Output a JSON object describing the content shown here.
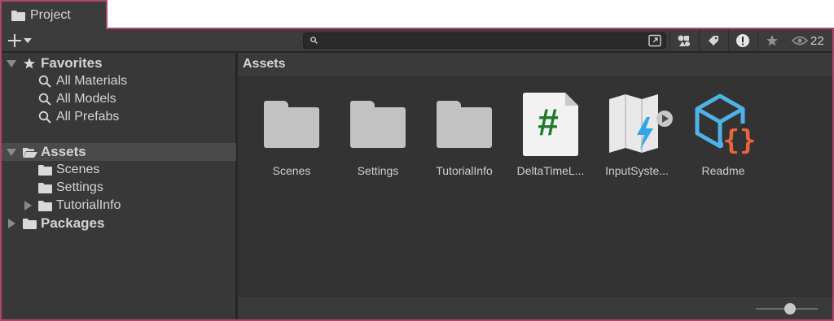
{
  "tab": {
    "title": "Project",
    "icon": "folder-icon"
  },
  "toolbar": {
    "add_icon": "plus-icon",
    "search": {
      "value": "",
      "placeholder": ""
    },
    "hidden_count": "22"
  },
  "tree": {
    "favorites": {
      "label": "Favorites",
      "items": [
        {
          "label": "All Materials"
        },
        {
          "label": "All Models"
        },
        {
          "label": "All Prefabs"
        }
      ]
    },
    "assets": {
      "label": "Assets",
      "children": [
        {
          "label": "Scenes"
        },
        {
          "label": "Settings"
        },
        {
          "label": "TutorialInfo"
        }
      ]
    },
    "packages": {
      "label": "Packages"
    }
  },
  "main": {
    "title": "Assets",
    "items": [
      {
        "name": "Scenes",
        "type": "folder"
      },
      {
        "name": "Settings",
        "type": "folder"
      },
      {
        "name": "TutorialInfo",
        "type": "folder"
      },
      {
        "name": "DeltaTimeL...",
        "type": "script"
      },
      {
        "name": "InputSyste...",
        "type": "input-actions"
      },
      {
        "name": "Readme",
        "type": "readme"
      }
    ],
    "zoom_level": 0.55
  },
  "colors": {
    "accent_border": "#b0456a",
    "script_hash": "#1e7a2f",
    "readme_blue": "#4fb3e6",
    "readme_orange": "#e8643a",
    "input_bolt": "#2fa6e8"
  }
}
